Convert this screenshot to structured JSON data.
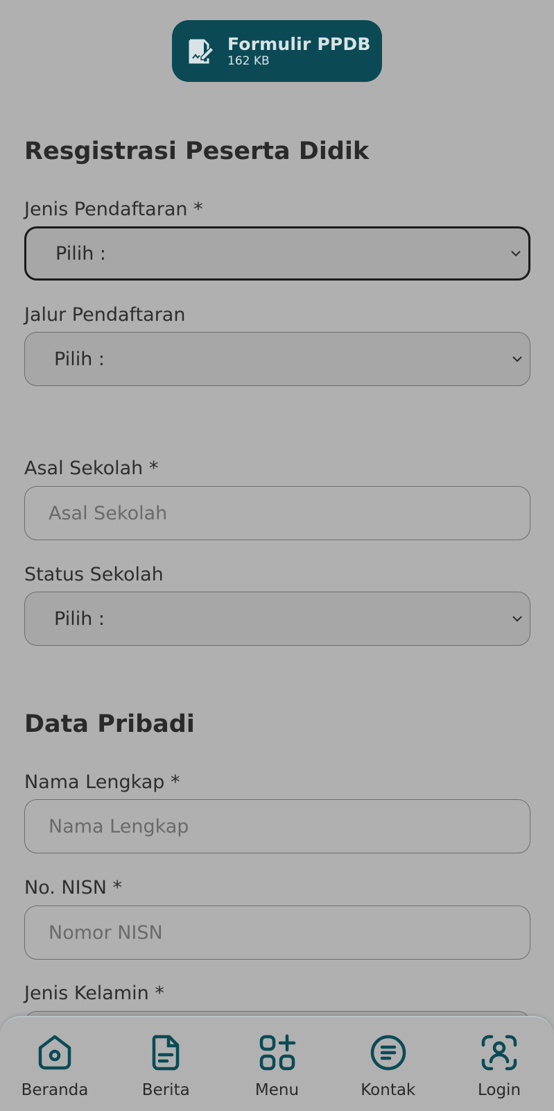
{
  "download": {
    "title": "Formulir PPDB",
    "size": "162 KB",
    "icon": "signed-document-icon",
    "color": "#0b4a55"
  },
  "registration": {
    "heading": "Resgistrasi Peserta Didik",
    "jenis_pendaftaran": {
      "label": "Jenis Pendaftaran *",
      "value": "Pilih :"
    },
    "jalur_pendaftaran": {
      "label": "Jalur Pendaftaran",
      "value": "Pilih :"
    },
    "asal_sekolah": {
      "label": "Asal Sekolah *",
      "placeholder": "Asal Sekolah"
    },
    "status_sekolah": {
      "label": "Status Sekolah",
      "value": "Pilih :"
    }
  },
  "personal": {
    "heading": "Data Pribadi",
    "nama_lengkap": {
      "label": "Nama Lengkap *",
      "placeholder": "Nama Lengkap"
    },
    "nisn": {
      "label": "No. NISN *",
      "placeholder": "Nomor NISN"
    },
    "jenis_kelamin": {
      "label": "Jenis Kelamin *"
    }
  },
  "bottom_nav": {
    "accent": "#0b4a55",
    "items": [
      {
        "label": "Beranda",
        "icon": "home-icon"
      },
      {
        "label": "Berita",
        "icon": "document-icon"
      },
      {
        "label": "Menu",
        "icon": "grid-plus-icon"
      },
      {
        "label": "Kontak",
        "icon": "message-icon"
      },
      {
        "label": "Login",
        "icon": "user-scan-icon"
      }
    ]
  }
}
